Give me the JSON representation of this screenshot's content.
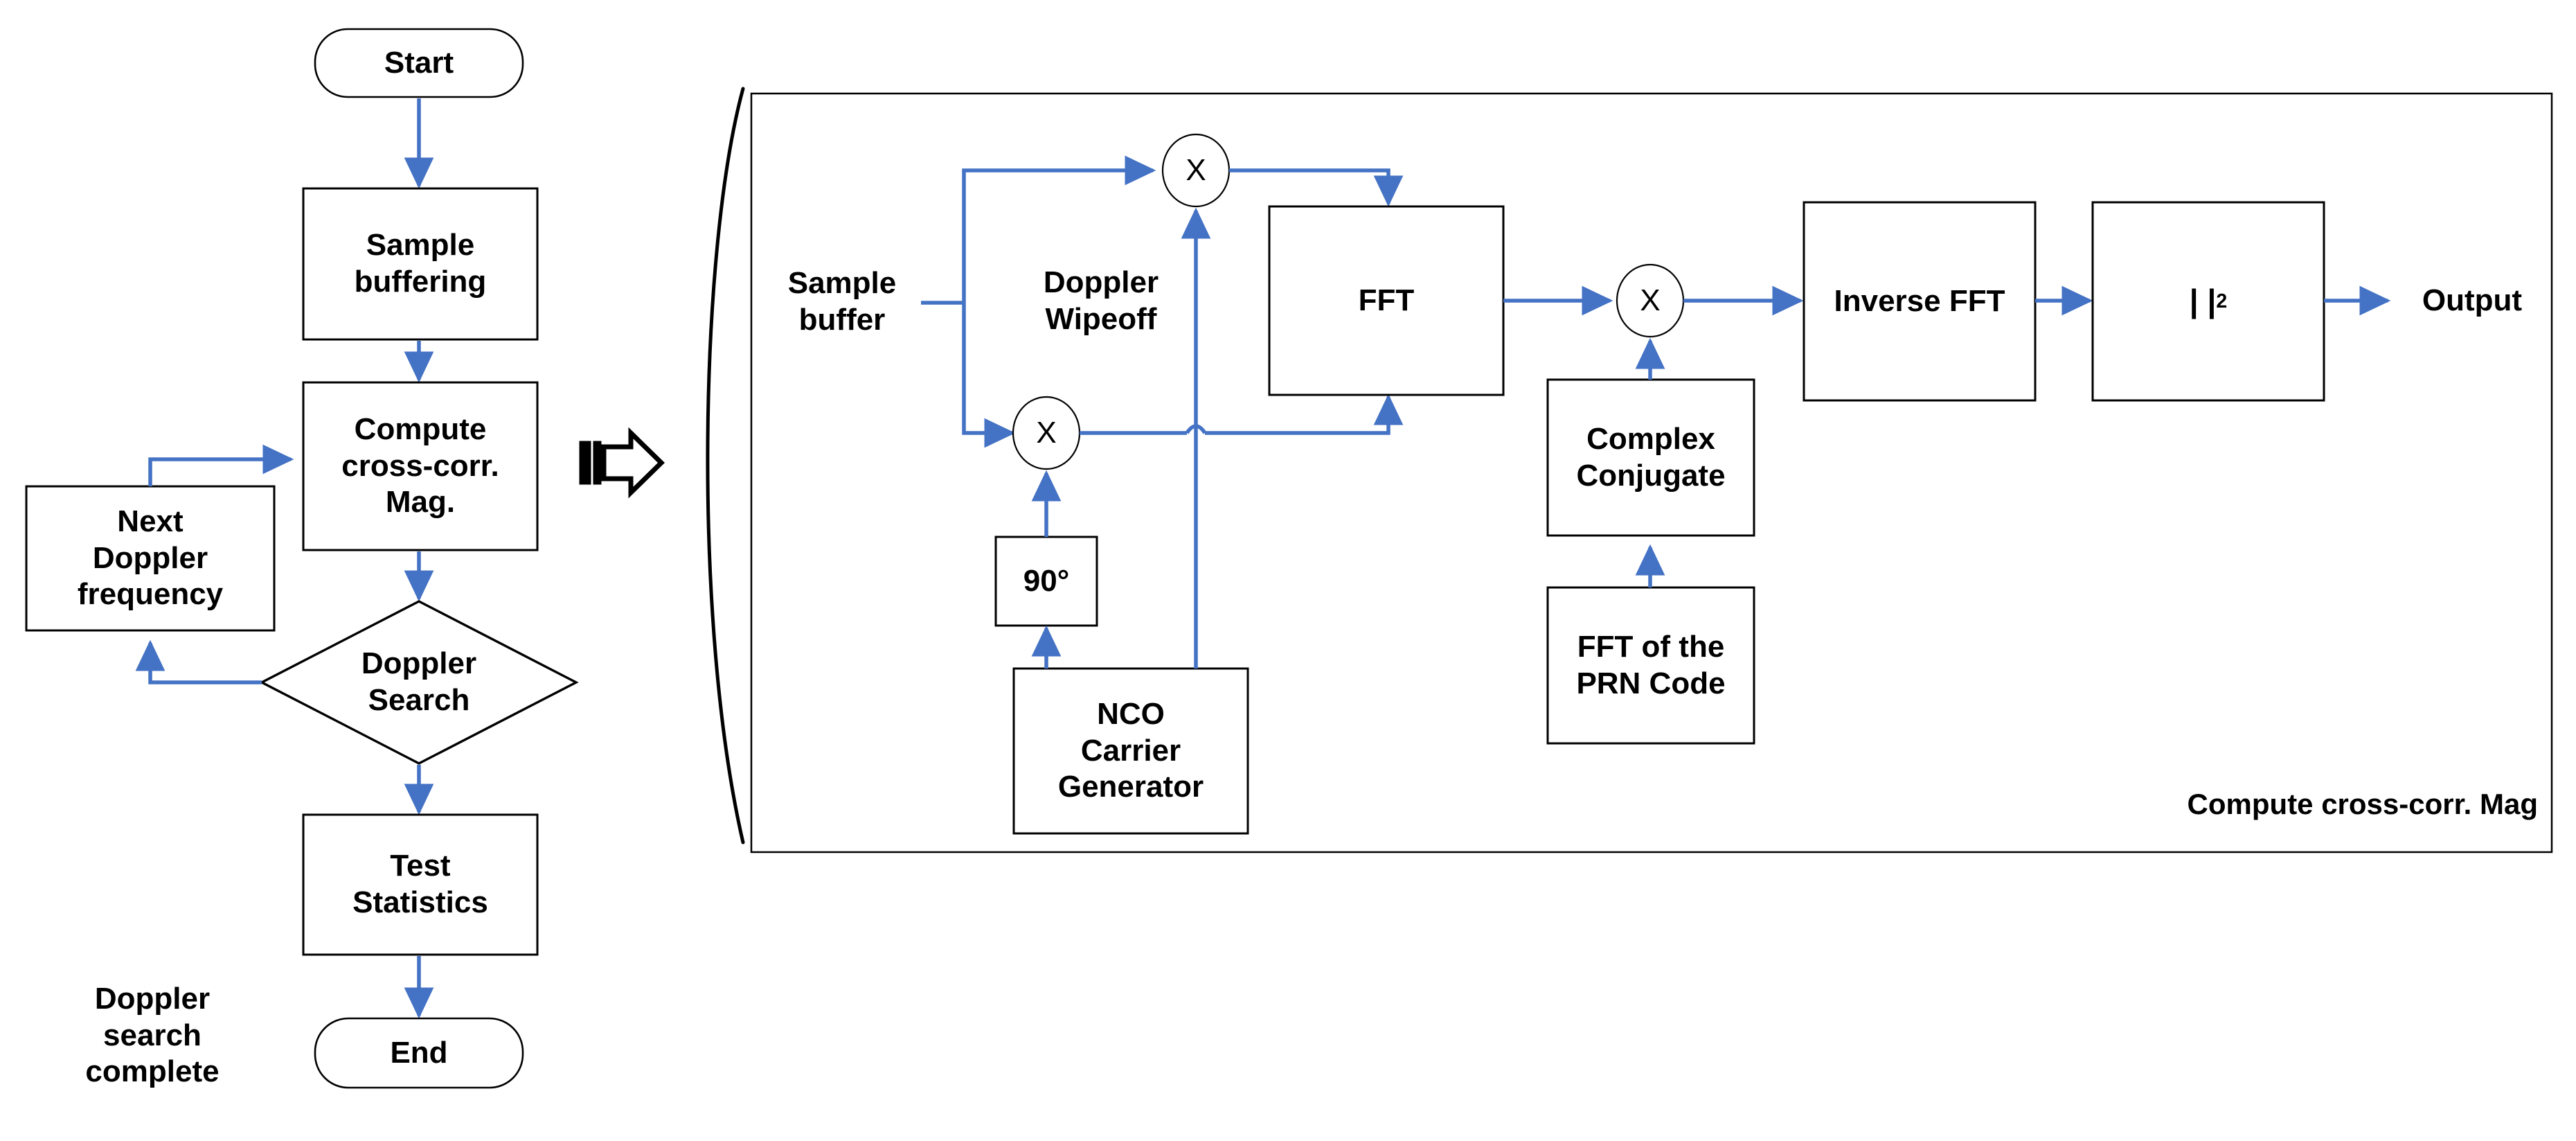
{
  "figure": {
    "title": "GNSS acquisition flowchart and cross-correlation magnitude block diagram",
    "accent_color": "#4472C4",
    "line_color": "#000000",
    "background": "#ffffff"
  },
  "flowchart": {
    "name": "Doppler search flowchart",
    "nodes": {
      "start": {
        "label": "Start",
        "shape": "terminator"
      },
      "sample_buffering": {
        "label": "Sample\nbuffering",
        "shape": "process"
      },
      "compute_cross_corr": {
        "label": "Compute\ncross-corr.\nMag.",
        "shape": "process"
      },
      "next_doppler": {
        "label": "Next\nDoppler\nfrequency",
        "shape": "process"
      },
      "doppler_search": {
        "label": "Doppler\nSearch",
        "shape": "decision"
      },
      "test_statistics": {
        "label": "Test\nStatistics",
        "shape": "process"
      },
      "end": {
        "label": "End",
        "shape": "terminator"
      }
    },
    "annotation": {
      "label": "Doppler\nsearch\ncomplete"
    },
    "expand_connector": {
      "icon": "block-arrow-right-icon"
    }
  },
  "block_diagram": {
    "caption": "Compute cross-corr. Mag",
    "group_label": "Doppler Wipeoff",
    "input_label": "Sample\nbuffer",
    "output_label": "Output",
    "blocks": {
      "fft": {
        "label": "FFT"
      },
      "inverse_fft": {
        "label": "Inverse FFT"
      },
      "magnitude_squared": {
        "label": "| |²",
        "base": "| |",
        "exponent": "2"
      },
      "complex_conjugate": {
        "label": "Complex\nConjugate"
      },
      "fft_prn_code": {
        "label": "FFT of the\nPRN Code"
      },
      "phase_shift": {
        "label": "90°"
      },
      "nco": {
        "label": "NCO\nCarrier\nGenerator"
      }
    },
    "multipliers": {
      "mixer_i": {
        "label": "X"
      },
      "mixer_q": {
        "label": "X"
      },
      "mixer_corr": {
        "label": "X"
      }
    }
  }
}
